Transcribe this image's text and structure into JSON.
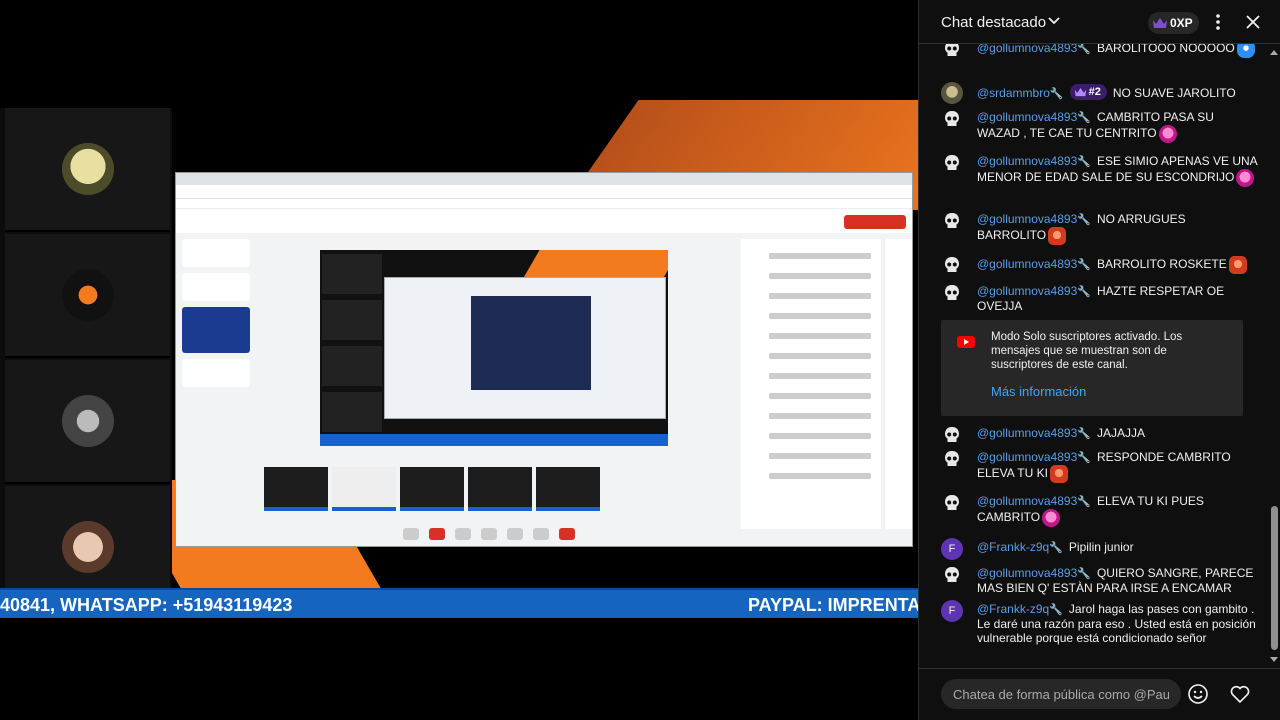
{
  "chat": {
    "title": "Chat destacado",
    "xp": "0XP",
    "messages": [
      {
        "author": "@gollumnova4893",
        "text": "BAROLITOOO NOOOOO",
        "avatar": "skull",
        "emoji": "blue"
      },
      {
        "author": "@srdammbro",
        "text": "NO SUAVE JAROLITO",
        "avatar": "photo",
        "rank": "#2"
      },
      {
        "author": "@gollumnova4893",
        "text": "CAMBRITO PASA SU WAZAD , TE CAE TU CENTRITO",
        "avatar": "skull",
        "emoji": "pink"
      },
      {
        "author": "@gollumnova4893",
        "text": "ESE SIMIO APENAS VE UNA MENOR DE EDAD SALE DE SU ESCONDRIJO",
        "avatar": "skull",
        "emoji": "pink"
      },
      {
        "author": "@gollumnova4893",
        "text": "NO ARRUGUES BARROLITO",
        "avatar": "skull",
        "emoji": "red"
      },
      {
        "author": "@gollumnova4893",
        "text": "BARROLITO ROSKETE",
        "avatar": "skull",
        "emoji": "red"
      },
      {
        "author": "@gollumnova4893",
        "text": "HAZTE RESPETAR OE OVEJJA",
        "avatar": "skull"
      },
      {
        "author": "@gollumnova4893",
        "text": "JAJAJJA",
        "avatar": "skull"
      },
      {
        "author": "@gollumnova4893",
        "text": "RESPONDE CAMBRITO ELEVA TU KI",
        "avatar": "skull",
        "emoji": "red"
      },
      {
        "author": "@gollumnova4893",
        "text": "ELEVA TU KI PUES CAMBRITO",
        "avatar": "skull",
        "emoji": "pink"
      },
      {
        "author": "@Frankk-z9q",
        "text": "Pipilin junior",
        "avatar": "F"
      },
      {
        "author": "@gollumnova4893",
        "text": "QUIERO SANGRE, PARECE MAS BIEN Q' ESTÀN PARA IRSE A ENCAMAR",
        "avatar": "skull"
      },
      {
        "author": "@Frankk-z9q",
        "text": "Jarol haga las pases con gambito . Le daré una razón para eso . Usted está en posición vulnerable porque está condicionado señor",
        "avatar": "F"
      }
    ],
    "notice": {
      "text": "Modo Solo suscriptores activado. Los mensajes que se muestran son de suscriptores de este canal.",
      "link": "Más información"
    },
    "input_placeholder": "Chatea de forma pública como @Paul..."
  },
  "video": {
    "ticker_left": "40841, WHATSAPP: +51943119423",
    "ticker_right": "PAYPAL: IMPRENTA"
  },
  "colors": {
    "author": "#5e9ee6",
    "accent_orange": "#f47a1f",
    "ticker_blue": "#1565c0",
    "link": "#3ea6ff"
  }
}
